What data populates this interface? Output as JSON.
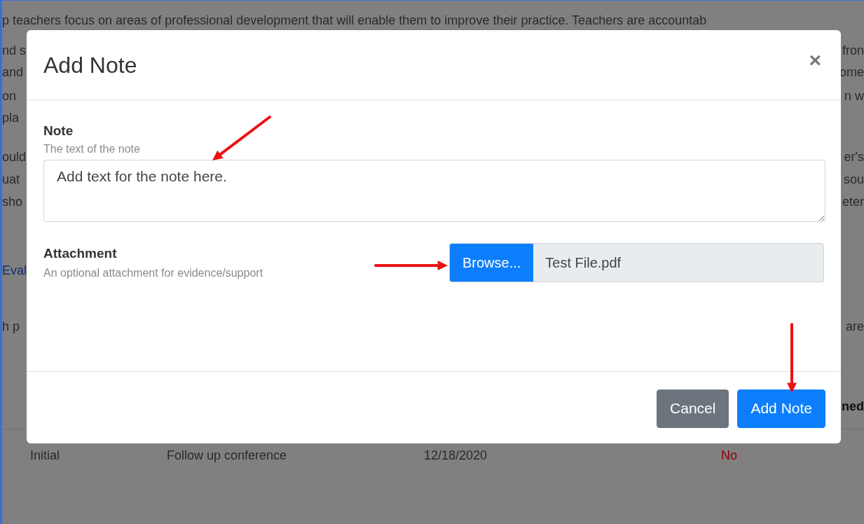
{
  "background": {
    "intro": "p teachers focus on areas of professional development that will enable them to improve their practice. Teachers are accountab",
    "fragments": [
      {
        "left": "nd s",
        "right": "fron",
        "kind": "text"
      },
      {
        "left": "and",
        "right": "ome",
        "kind": "text"
      },
      {
        "left": "on",
        "right": "n w",
        "kind": "text"
      },
      {
        "left": "pla",
        "kind": "text"
      },
      {
        "left": "ould",
        "right": "er's",
        "kind": "text"
      },
      {
        "left": "uat",
        "right": "sou",
        "kind": "text"
      },
      {
        "left": "sho",
        "right": "eter",
        "kind": "text"
      },
      {
        "left": "Eval",
        "kind": "link"
      },
      {
        "left": "h p",
        "right": "are",
        "kind": "text"
      },
      {
        "right": "ned",
        "kind": "bold"
      }
    ],
    "table_row": [
      {
        "text": "Initial",
        "kind": "text"
      },
      {
        "text": "Follow up conference",
        "kind": "text"
      },
      {
        "text": "12/18/2020",
        "kind": "text"
      },
      {
        "text": "No",
        "kind": "negative"
      }
    ]
  },
  "dialog": {
    "title": "Add Note",
    "close": "×",
    "note": {
      "label": "Note",
      "help": "The text of the note",
      "value": "Add text for the note here."
    },
    "attachment": {
      "label": "Attachment",
      "help": "An optional attachment for evidence/support",
      "button": "Browse...",
      "file": "Test File.pdf"
    },
    "buttons": [
      {
        "label": "Cancel",
        "kind": "secondary"
      },
      {
        "label": "Add Note",
        "kind": "primary"
      }
    ]
  }
}
